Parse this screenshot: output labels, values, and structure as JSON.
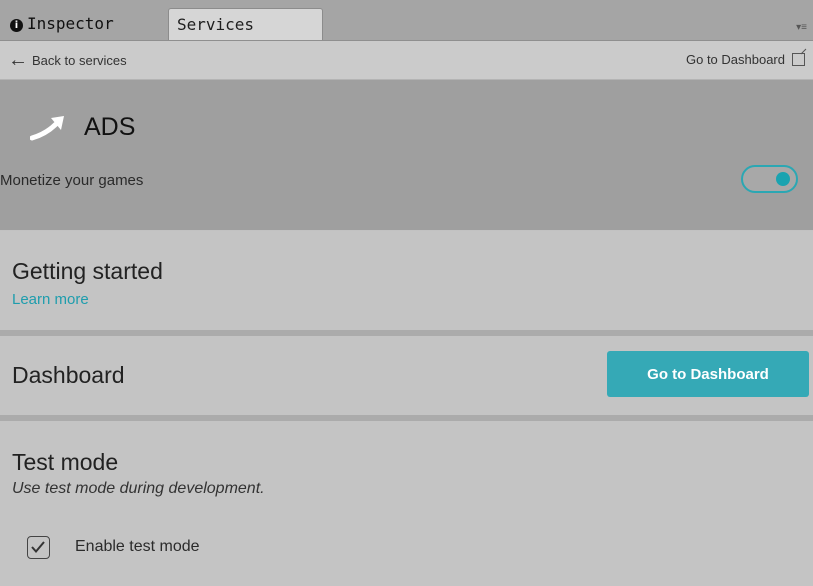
{
  "tabs": {
    "inspector": "Inspector",
    "services": "Services"
  },
  "nav": {
    "back": "Back to services",
    "dashboard_link": "Go to Dashboard"
  },
  "service": {
    "name": "ADS",
    "description": "Monetize your games",
    "enabled": true,
    "accent": "#1aa3b0"
  },
  "getting_started": {
    "title": "Getting started",
    "link": "Learn more"
  },
  "dashboard": {
    "title": "Dashboard",
    "button": "Go to Dashboard"
  },
  "test_mode": {
    "title": "Test mode",
    "subtitle": "Use test mode during development.",
    "checkbox_label": "Enable test mode",
    "checked": true
  },
  "icons": [
    "info-icon",
    "menu-icon",
    "back-arrow-icon",
    "external-link-icon",
    "ads-arrow-icon",
    "checkmark-icon"
  ]
}
